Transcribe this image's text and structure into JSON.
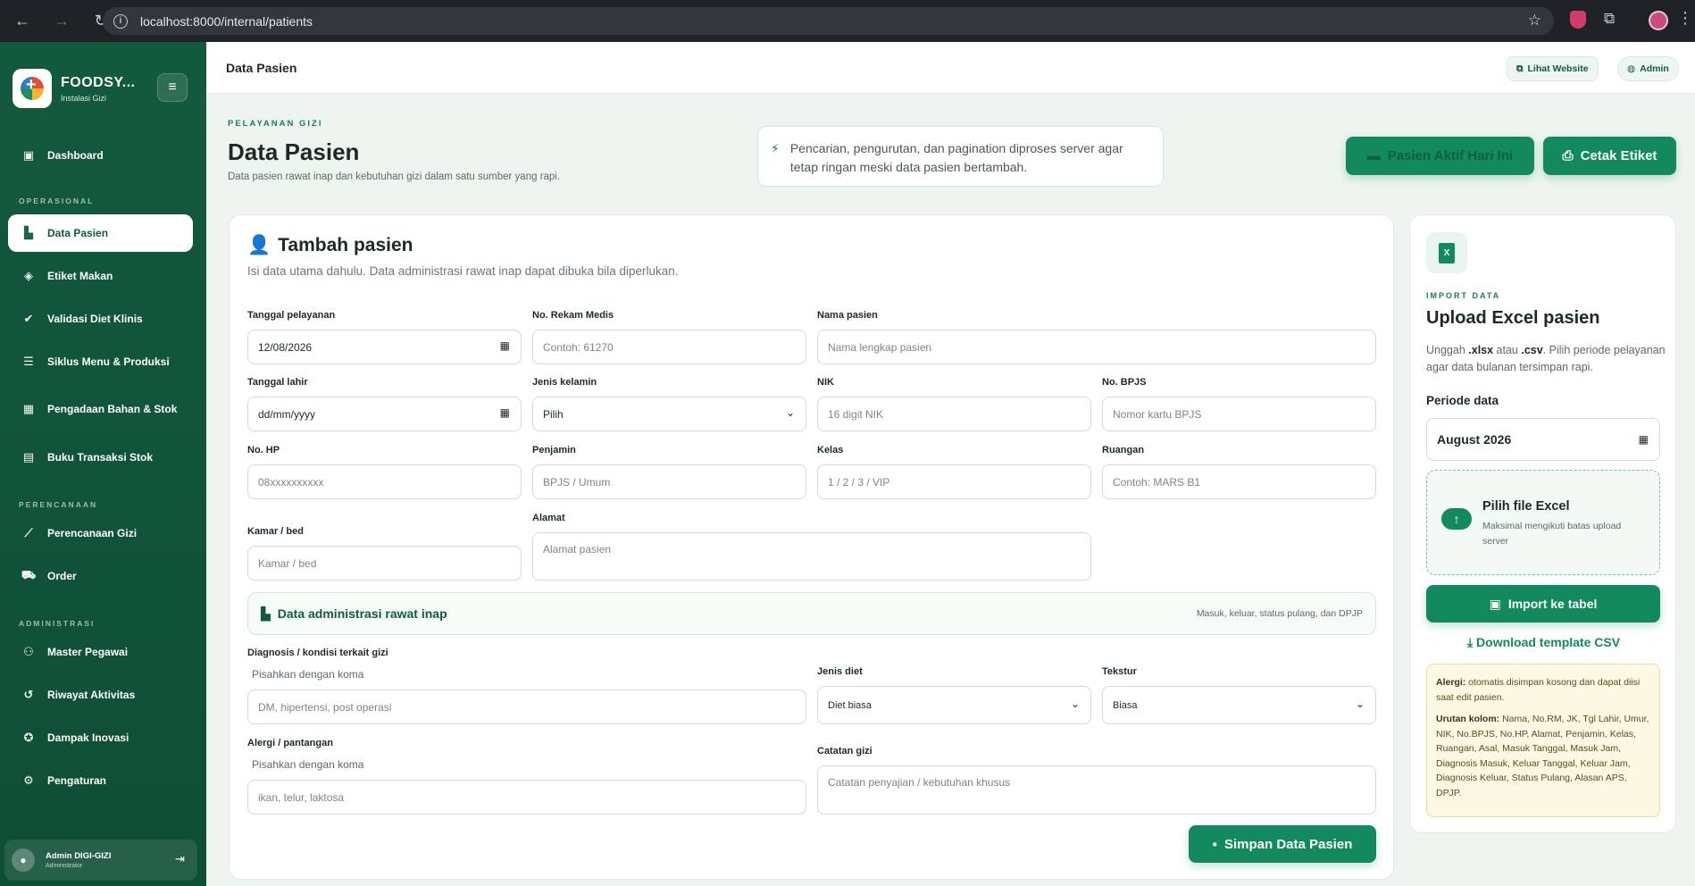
{
  "browser": {
    "url": "localhost:8000/internal/patients"
  },
  "sidebar": {
    "brand_name": "FOODSY...",
    "brand_sub": "Instalasi Gizi",
    "sections": {
      "operasional": "OPERASIONAL",
      "perencanaan": "PERENCANAAN",
      "administrasi": "ADMINISTRASI"
    },
    "items": [
      {
        "label": "Dashboard",
        "icon": "dashboard-icon"
      },
      {
        "label": "Data Pasien",
        "icon": "patient-data-icon",
        "active": true
      },
      {
        "label": "Etiket Makan",
        "icon": "tag-icon"
      },
      {
        "label": "Validasi Diet Klinis",
        "icon": "user-check-icon"
      },
      {
        "label": "Siklus Menu & Produksi",
        "icon": "menu-cycle-icon"
      },
      {
        "label": "Pengadaan Bahan & Stok",
        "icon": "boxes-icon"
      },
      {
        "label": "Buku Transaksi Stok",
        "icon": "book-icon"
      },
      {
        "label": "Perencanaan Gizi",
        "icon": "chart-line-icon"
      },
      {
        "label": "Order",
        "icon": "cart-icon"
      },
      {
        "label": "Master Pegawai",
        "icon": "users-icon"
      },
      {
        "label": "Riwayat Aktivitas",
        "icon": "history-icon"
      },
      {
        "label": "Dampak Inovasi",
        "icon": "award-icon"
      },
      {
        "label": "Pengaturan",
        "icon": "gear-icon"
      }
    ],
    "user": {
      "name": "Admin DIGI-GIZI",
      "role": "Administrator"
    }
  },
  "topbar": {
    "title": "Data Pasien",
    "site_label": "Lihat Website",
    "admin_label": "Admin"
  },
  "hero": {
    "kicker": "PELAYANAN GIZI",
    "title": "Data Pasien",
    "subtitle": "Data pasien rawat inap dan kebutuhan gizi dalam satu sumber yang rapi.",
    "notice": "Pencarian, pengurutan, dan pagination diproses server agar tetap ringan meski data pasien bertambah.",
    "btn_active": "Pasien Aktif Hari Ini",
    "btn_print": "Cetak Etiket"
  },
  "form": {
    "title": "Tambah pasien",
    "subtitle": "Isi data utama dahulu. Data administrasi rawat inap dapat dibuka bila diperlukan.",
    "fields": {
      "tanggal_pelayanan": {
        "label": "Tanggal pelayanan",
        "value": "12/08/2026"
      },
      "no_rm": {
        "label": "No. Rekam Medis",
        "placeholder": "Contoh: 61270"
      },
      "nama": {
        "label": "Nama pasien",
        "placeholder": "Nama lengkap pasien"
      },
      "tanggal_lahir": {
        "label": "Tanggal lahir",
        "value": "dd/mm/yyyy"
      },
      "jenis_kelamin": {
        "label": "Jenis kelamin",
        "value": "Pilih"
      },
      "nik": {
        "label": "NIK",
        "placeholder": "16 digit NIK"
      },
      "bpjs": {
        "label": "No. BPJS",
        "placeholder": "Nomor kartu BPJS"
      },
      "hp": {
        "label": "No. HP",
        "placeholder": "08xxxxxxxxxx"
      },
      "penjamin": {
        "label": "Penjamin",
        "placeholder": "BPJS / Umum"
      },
      "kelas": {
        "label": "Kelas",
        "placeholder": "1 / 2 / 3 / VIP"
      },
      "ruangan": {
        "label": "Ruangan",
        "placeholder": "Contoh: MARS B1"
      },
      "kamar": {
        "label": "Kamar / bed",
        "placeholder": "Kamar / bed"
      },
      "alamat": {
        "label": "Alamat",
        "placeholder": "Alamat pasien"
      },
      "diagnosis": {
        "label": "Diagnosis / kondisi terkait gizi",
        "hint": "Pisahkan dengan koma",
        "placeholder": "DM, hipertensi, post operasi"
      },
      "jenis_diet": {
        "label": "Jenis diet",
        "value": "Diet biasa"
      },
      "tekstur": {
        "label": "Tekstur",
        "value": "Biasa"
      },
      "alergi": {
        "label": "Alergi / pantangan",
        "hint": "Pisahkan dengan koma",
        "placeholder": "ikan, telur, laktosa"
      },
      "catatan": {
        "label": "Catatan gizi",
        "placeholder": "Catatan penyajian / kebutuhan khusus"
      }
    },
    "admin_section": {
      "title": "Data administrasi rawat inap",
      "note": "Masuk, keluar, status pulang, dan DPJP"
    },
    "save_label": "Simpan Data Pasien"
  },
  "upload": {
    "kicker": "IMPORT DATA",
    "title": "Upload Excel pasien",
    "desc_pre": "Unggah ",
    "desc_xlsx": ".xlsx",
    "desc_mid": " atau ",
    "desc_csv": ".csv",
    "desc_post": ". Pilih periode pelayanan agar data bulanan tersimpan rapi.",
    "period_label": "Periode data",
    "period_value": "August 2026",
    "drop_title": "Pilih file Excel",
    "drop_sub": "Maksimal mengikuti batas upload server",
    "import_label": "Import ke tabel",
    "download_label": "Download template CSV",
    "info_allergy_label": "Alergi:",
    "info_allergy_text": " otomatis disimpan kosong dan dapat diisi saat edit pasien.",
    "info_order_label": "Urutan kolom:",
    "info_order_text": " Nama, No.RM, JK, Tgl Lahir, Umur, NIK, No.BPJS, No.HP, Alamat, Penjamin, Kelas, Ruangan, Asal, Masuk Tanggal, Masuk Jam, Diagnosis Masuk, Keluar Tanggal, Keluar Jam, Diagnosis Keluar, Status Pulang, Alasan APS, DPJP."
  },
  "colors": {
    "sidebar": "#125a3e",
    "accent": "#138a5e",
    "background": "#eef5f1",
    "info_box": "#fdf8e4"
  }
}
